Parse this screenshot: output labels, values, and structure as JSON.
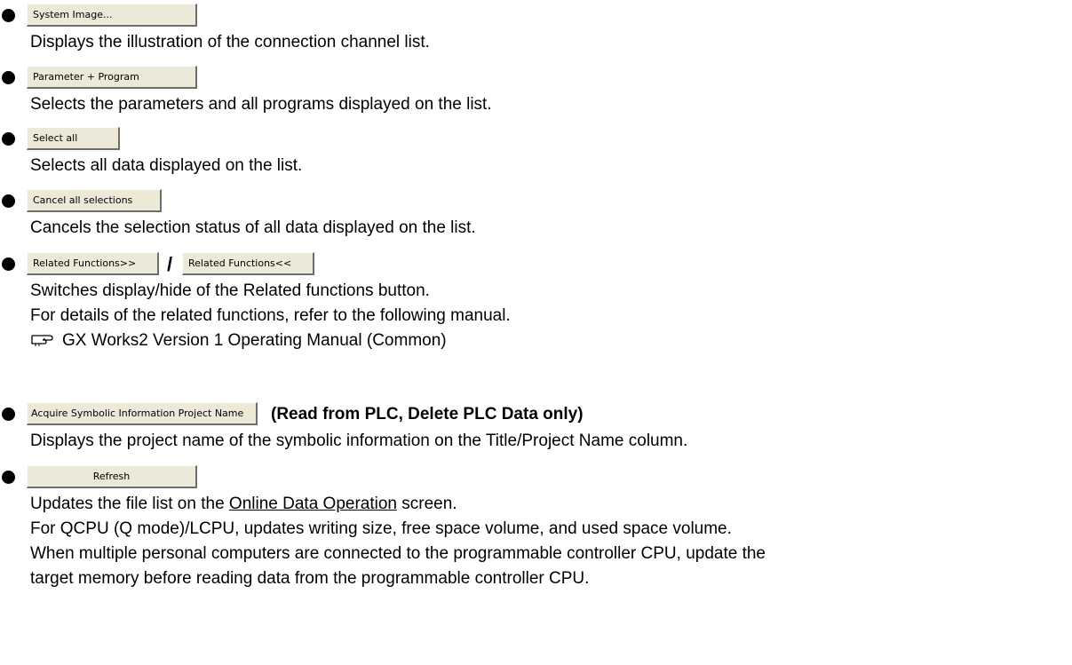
{
  "items": [
    {
      "button": "System Image...",
      "lines": [
        "Displays the illustration of the connection channel list."
      ]
    },
    {
      "button": "Parameter + Program",
      "lines": [
        "Selects the parameters and all programs displayed on the list."
      ]
    },
    {
      "button": "Select all",
      "lines": [
        "Selects all data displayed on the list."
      ]
    },
    {
      "button": "Cancel all selections",
      "lines": [
        "Cancels the selection status of all data displayed on the list."
      ]
    },
    {
      "button": "Related Functions>>",
      "separator": "/",
      "button2": "Related Functions<<",
      "lines": [
        "Switches display/hide of the Related functions button.",
        "For details of the related functions, refer to the following manual."
      ],
      "reference": "GX Works2 Version 1 Operating Manual (Common)"
    },
    {
      "button": "Acquire Symbolic Information Project Name",
      "note": "(Read from PLC, Delete PLC Data only)",
      "lines": [
        "Displays the project name of the symbolic information on the Title/Project Name column."
      ]
    },
    {
      "button": "Refresh",
      "line1_prefix": "Updates the file list on the ",
      "line1_link": "Online Data Operation",
      "line1_suffix": " screen.",
      "lines": [
        "For QCPU (Q mode)/LCPU, updates writing size, free space volume, and used space volume.",
        "When multiple personal computers are connected to the programmable controller CPU, update the",
        "target memory before reading data from the programmable controller CPU."
      ]
    }
  ]
}
